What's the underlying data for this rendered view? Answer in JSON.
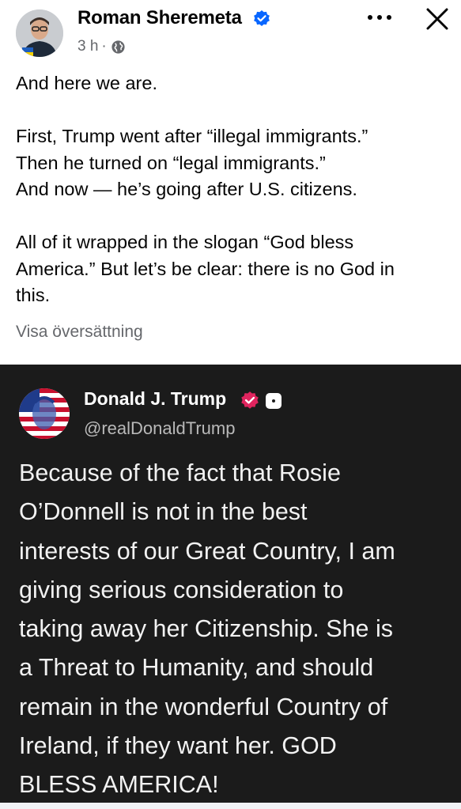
{
  "post": {
    "author": "Roman Sheremeta",
    "time": "3 h",
    "dot": "·",
    "paragraphs": [
      [
        "And here we are."
      ],
      [
        "First, Trump went after “illegal immigrants.”",
        "Then he turned on “legal immigrants.”",
        "And now — he’s going after U.S. citizens."
      ],
      [
        "All of it wrapped in the slogan “God bless",
        "America.” But let’s be clear: there is no God in",
        "this."
      ]
    ],
    "translate_label": "Visa översättning"
  },
  "embed": {
    "name": "Donald J. Trump",
    "handle": "@realDonaldTrump",
    "lines": [
      "Because of the fact that Rosie",
      "O’Donnell is not in the best",
      "interests of our Great Country, I am",
      "giving serious consideration to",
      "taking away her Citizenship. She is",
      "a Threat to Humanity, and should",
      "remain in the wonderful Country of",
      "Ireland, if they want her. GOD",
      "BLESS AMERICA!"
    ]
  },
  "icons": {
    "verified": "verified-badge-icon",
    "globe": "globe-icon",
    "more": "more-options-icon",
    "close": "close-icon",
    "truth_verified": "truth-verified-badge-icon"
  },
  "colors": {
    "verified_blue": "#0866ff",
    "secondary_text": "#65676b",
    "dark_background": "#1b1b1b",
    "truth_badge": "#e0245e"
  }
}
